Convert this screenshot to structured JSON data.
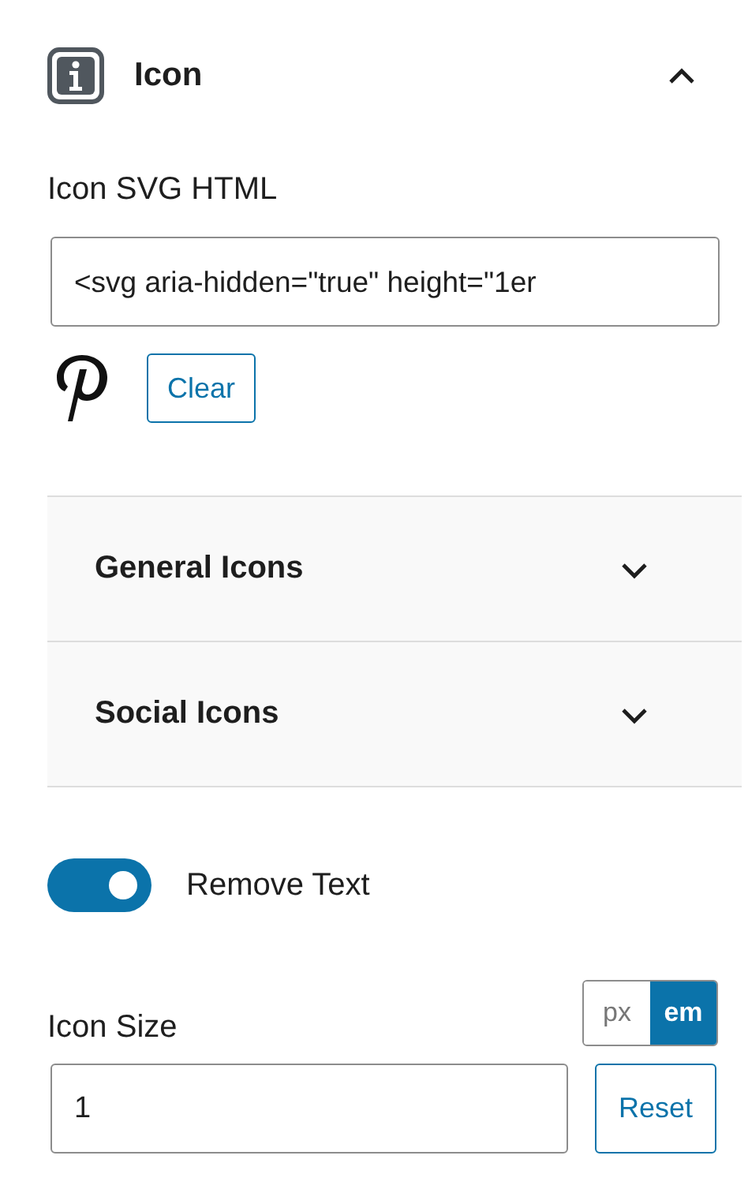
{
  "panel": {
    "title": "Icon",
    "expanded": true
  },
  "svg_field": {
    "label": "Icon SVG HTML",
    "value": "<svg aria-hidden=\"true\" height=\"1er"
  },
  "clear_button": "Clear",
  "sections": [
    {
      "title": "General Icons",
      "expanded": false
    },
    {
      "title": "Social Icons",
      "expanded": false
    }
  ],
  "remove_text": {
    "label": "Remove Text",
    "on": true
  },
  "icon_size": {
    "label": "Icon Size",
    "units": [
      {
        "label": "px",
        "selected": false
      },
      {
        "label": "em",
        "selected": true
      }
    ],
    "value": "1",
    "reset": "Reset"
  }
}
